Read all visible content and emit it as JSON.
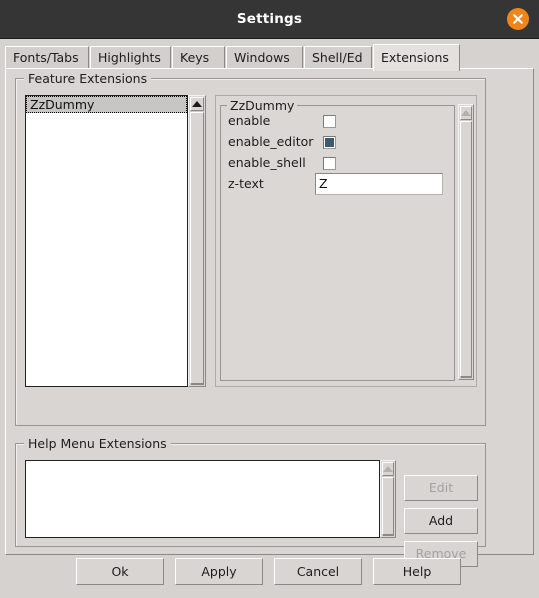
{
  "window": {
    "title": "Settings",
    "close_icon": "close-x-icon"
  },
  "tabs": [
    {
      "label": "Fonts/Tabs",
      "selected": false
    },
    {
      "label": "Highlights",
      "selected": false
    },
    {
      "label": "Keys",
      "selected": false
    },
    {
      "label": "Windows",
      "selected": false
    },
    {
      "label": "Shell/Ed",
      "selected": false
    },
    {
      "label": "Extensions",
      "selected": true
    }
  ],
  "feature_extensions": {
    "frame_title": "Feature Extensions",
    "list_items": [
      {
        "label": "ZzDummy",
        "selected": true
      }
    ],
    "scrollbar": {
      "up_icon": "triangle-up-icon",
      "down_icon": "triangle-down-icon",
      "enabled": true
    },
    "detail": {
      "frame_title": "ZzDummy",
      "options": [
        {
          "name": "enable",
          "label": "enable",
          "type": "checkbox",
          "checked": false
        },
        {
          "name": "enable_editor",
          "label": "enable_editor",
          "type": "checkbox",
          "checked": true
        },
        {
          "name": "enable_shell",
          "label": "enable_shell",
          "type": "checkbox",
          "checked": false
        },
        {
          "name": "z-text",
          "label": "z-text",
          "type": "text",
          "value": "Z"
        }
      ],
      "scrollbar": {
        "up_icon": "triangle-up-icon",
        "down_icon": "triangle-down-icon",
        "enabled": false
      }
    }
  },
  "help_menu_extensions": {
    "frame_title": "Help Menu Extensions",
    "list_items": [],
    "scrollbar": {
      "up_icon": "triangle-up-icon",
      "down_icon": "triangle-down-icon",
      "enabled": false
    },
    "buttons": [
      {
        "label": "Edit",
        "enabled": false
      },
      {
        "label": "Add",
        "enabled": true
      },
      {
        "label": "Remove",
        "enabled": false
      }
    ]
  },
  "dialog_buttons": [
    {
      "label": "Ok"
    },
    {
      "label": "Apply"
    },
    {
      "label": "Cancel"
    },
    {
      "label": "Help"
    }
  ],
  "colors": {
    "titlebar_bg": "#353535",
    "close_button": "#f0861a",
    "panel_bg": "#d6d2d0",
    "selection_bg": "#c8c6c4",
    "checkbox_checked": "#3c5a70"
  }
}
